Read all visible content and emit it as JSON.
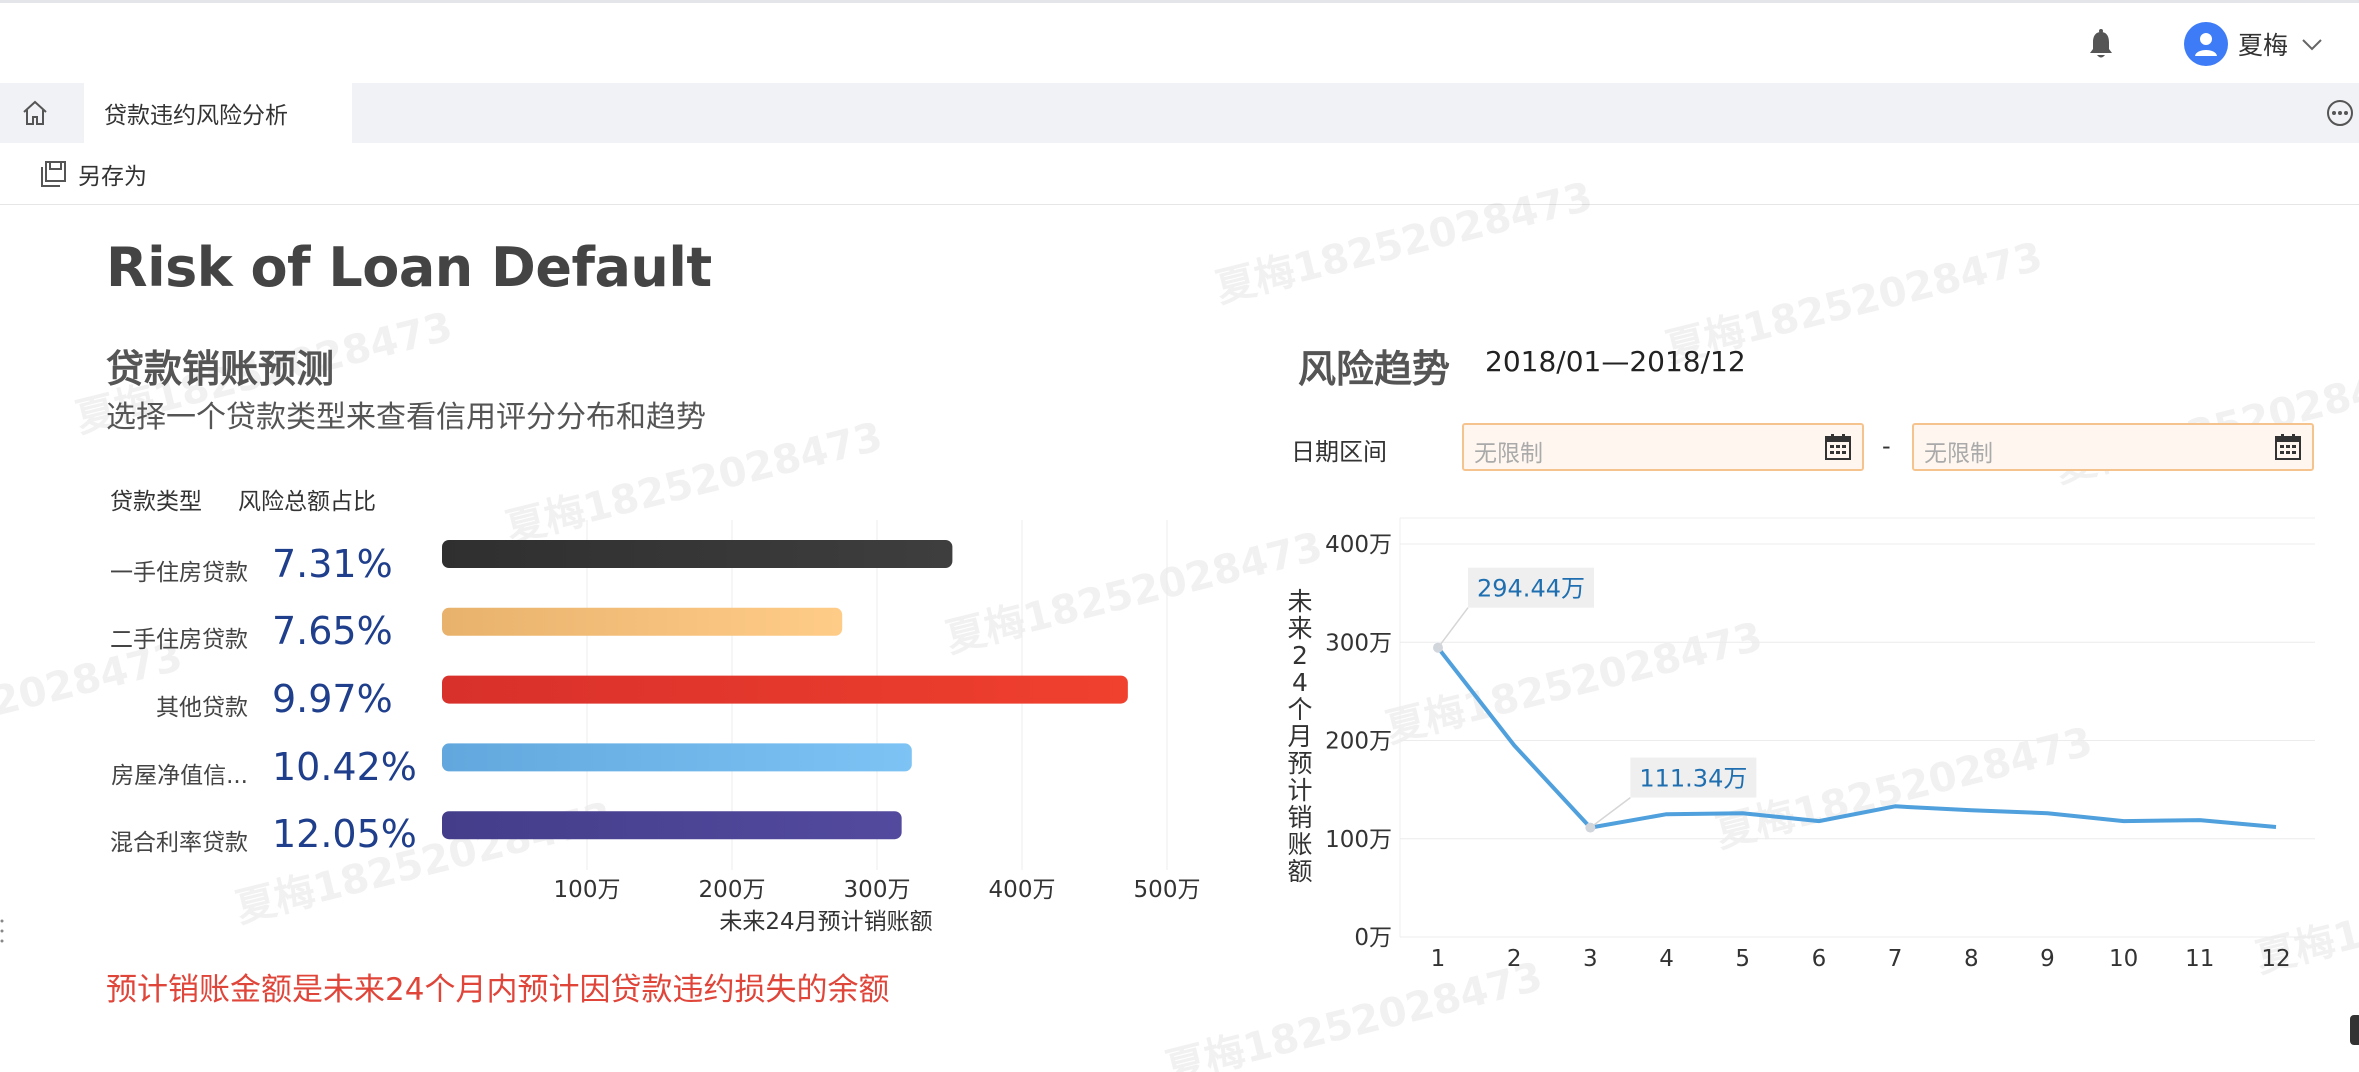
{
  "header": {
    "user_name": "夏梅",
    "icons": {
      "bell": "bell-icon",
      "user": "user-avatar-icon",
      "chevron": "chevron-down-icon"
    }
  },
  "tabs": {
    "home_icon": "home-icon",
    "active_label": "贷款违约风险分析",
    "more_icon": "more-icon"
  },
  "toolbar": {
    "save_as_label": "另存为",
    "save_icon": "save-as-icon"
  },
  "watermark": "夏梅18252028473",
  "page": {
    "title": "Risk of Loan Default"
  },
  "left_panel": {
    "title": "贷款销账预测",
    "subtitle": "选择一个贷款类型来查看信用评分分布和趋势",
    "col_type": "贷款类型",
    "col_ratio": "风险总额占比",
    "footnote": "预计销账金额是未来24个月内预计因贷款违约损失的余额"
  },
  "right_panel": {
    "title": "风险趋势",
    "date_range": "2018/01—2018/12",
    "date_label": "日期区间",
    "date_start_placeholder": "无限制",
    "date_end_placeholder": "无限制",
    "date_separator": "-",
    "calendar_icon": "calendar-icon"
  },
  "chart_data": [
    {
      "type": "bar",
      "orientation": "horizontal",
      "categories": [
        "一手住房贷款",
        "二手住房贷款",
        "其他贷款",
        "房屋净值信...",
        "混合利率贷款"
      ],
      "ratios": [
        "7.31%",
        "7.65%",
        "9.97%",
        "10.42%",
        "12.05%"
      ],
      "values": [
        3520000,
        2760000,
        4730000,
        3240000,
        3170000
      ],
      "xlabel": "未来24月预计销账额",
      "xlim": [
        0,
        5200000
      ],
      "xticks": [
        1000000,
        2000000,
        3000000,
        4000000,
        5000000
      ],
      "xtick_labels": [
        "100万",
        "200万",
        "300万",
        "400万",
        "500万"
      ],
      "colors": [
        [
          "#2f2f2f",
          "#3e3e3e"
        ],
        [
          "#e8b26c",
          "#ffcc88"
        ],
        [
          "#d8302b",
          "#f0402e"
        ],
        [
          "#62a8de",
          "#7dc3f4"
        ],
        [
          "#433d8a",
          "#534a9e"
        ]
      ],
      "grid": true
    },
    {
      "type": "line",
      "x": [
        1,
        2,
        3,
        4,
        5,
        6,
        7,
        8,
        9,
        10,
        11,
        12
      ],
      "values": [
        2944400,
        1950000,
        1113400,
        1250000,
        1260000,
        1180000,
        1330000,
        1290000,
        1260000,
        1180000,
        1190000,
        1120000
      ],
      "ylabel": "未来24个月预计销账额",
      "ylim": [
        0,
        4000000
      ],
      "yticks": [
        0,
        1000000,
        2000000,
        3000000,
        4000000
      ],
      "ytick_labels": [
        "0万",
        "100万",
        "200万",
        "300万",
        "400万"
      ],
      "data_labels": [
        {
          "x": 1,
          "text": "294.44万"
        },
        {
          "x": 3,
          "text": "111.34万"
        }
      ],
      "color": "#4fa0dc",
      "grid": true
    }
  ]
}
